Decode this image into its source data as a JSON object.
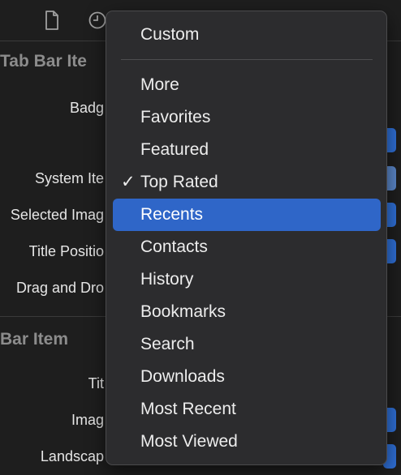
{
  "inspector": {
    "section_tab_bar_item": "Tab Bar Ite",
    "badge_label": "Badg",
    "system_item_label": "System Ite",
    "selected_image_label": "Selected Imag",
    "title_position_label": "Title Positio",
    "drag_drop_label": "Drag and Dro",
    "section_bar_item": "Bar Item",
    "title_label": "Tit",
    "image_label": "Imag",
    "landscape_label": "Landscap"
  },
  "menu": {
    "items": [
      {
        "label": "Custom"
      },
      {
        "label": "More"
      },
      {
        "label": "Favorites"
      },
      {
        "label": "Featured"
      },
      {
        "label": "Top Rated",
        "checked": true
      },
      {
        "label": "Recents",
        "highlighted": true
      },
      {
        "label": "Contacts"
      },
      {
        "label": "History"
      },
      {
        "label": "Bookmarks"
      },
      {
        "label": "Search"
      },
      {
        "label": "Downloads"
      },
      {
        "label": "Most Recent"
      },
      {
        "label": "Most Viewed"
      }
    ],
    "checkmark": "✓"
  },
  "colors": {
    "highlight": "#2f66c8",
    "background": "#1e1e1e",
    "menu_background": "#2c2c2e"
  }
}
